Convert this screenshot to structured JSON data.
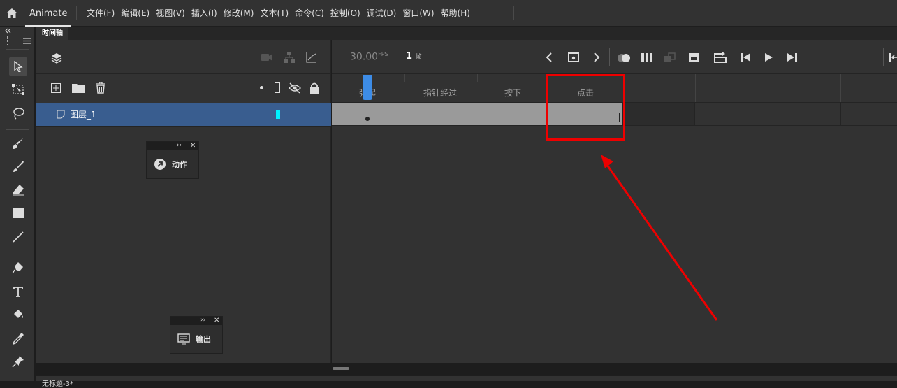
{
  "app": {
    "name": "Animate"
  },
  "menu": [
    "文件(F)",
    "编辑(E)",
    "视图(V)",
    "插入(I)",
    "修改(M)",
    "文本(T)",
    "命令(C)",
    "控制(O)",
    "调试(D)",
    "窗口(W)",
    "帮助(H)"
  ],
  "tabs": {
    "timeline": "时间轴"
  },
  "timeline": {
    "fps_value": "30.00",
    "fps_unit": "FPS",
    "frame_value": "1",
    "frame_unit": "帧",
    "ruler_labels": [
      "弹起",
      "指针经过",
      "按下",
      "点击"
    ]
  },
  "layers": [
    {
      "name": "图层_1",
      "color": "#00f0ff"
    }
  ],
  "panels": {
    "actions": "动作",
    "output": "输出"
  },
  "bottom": {
    "tab": "无标题-3*"
  },
  "colors": {
    "selected_layer": "#395d8f",
    "playhead": "#3d8ce6",
    "annotation": "#e00000"
  }
}
